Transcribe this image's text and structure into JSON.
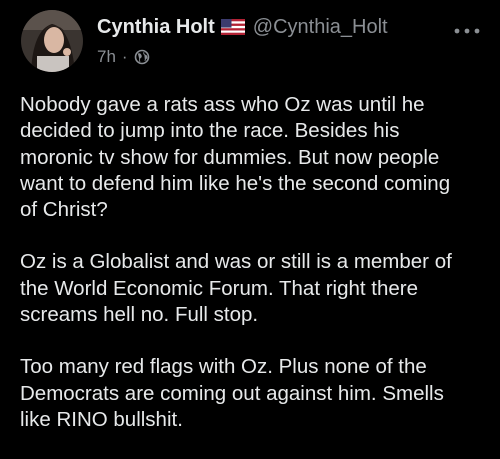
{
  "post": {
    "author": {
      "display_name": "Cynthia Holt",
      "flag_icon": "us-flag-icon",
      "handle": "@Cynthia_Holt"
    },
    "meta": {
      "time": "7h",
      "separator": "·",
      "visibility_icon": "globe-icon"
    },
    "more_icon": "more-dots-icon",
    "paragraphs": [
      {
        "lines": [
          "Nobody gave a rats ass who Oz was until he",
          "decided to jump into the race. Besides his",
          "moronic tv show for dummies. But now people",
          "want to defend him like he's the second coming",
          "of Christ?"
        ]
      },
      {
        "lines": [
          "Oz is a Globalist and was or still is a member of",
          "the World Economic Forum. That right there",
          "screams hell no. Full stop."
        ]
      },
      {
        "lines": [
          "Too many red flags with Oz. Plus none of the",
          "Democrats are coming out against him. Smells",
          "like RINO bullshit."
        ]
      }
    ]
  },
  "colors": {
    "background": "#000000",
    "text": "#e7e9ea",
    "secondary_text": "#8b8f94"
  }
}
